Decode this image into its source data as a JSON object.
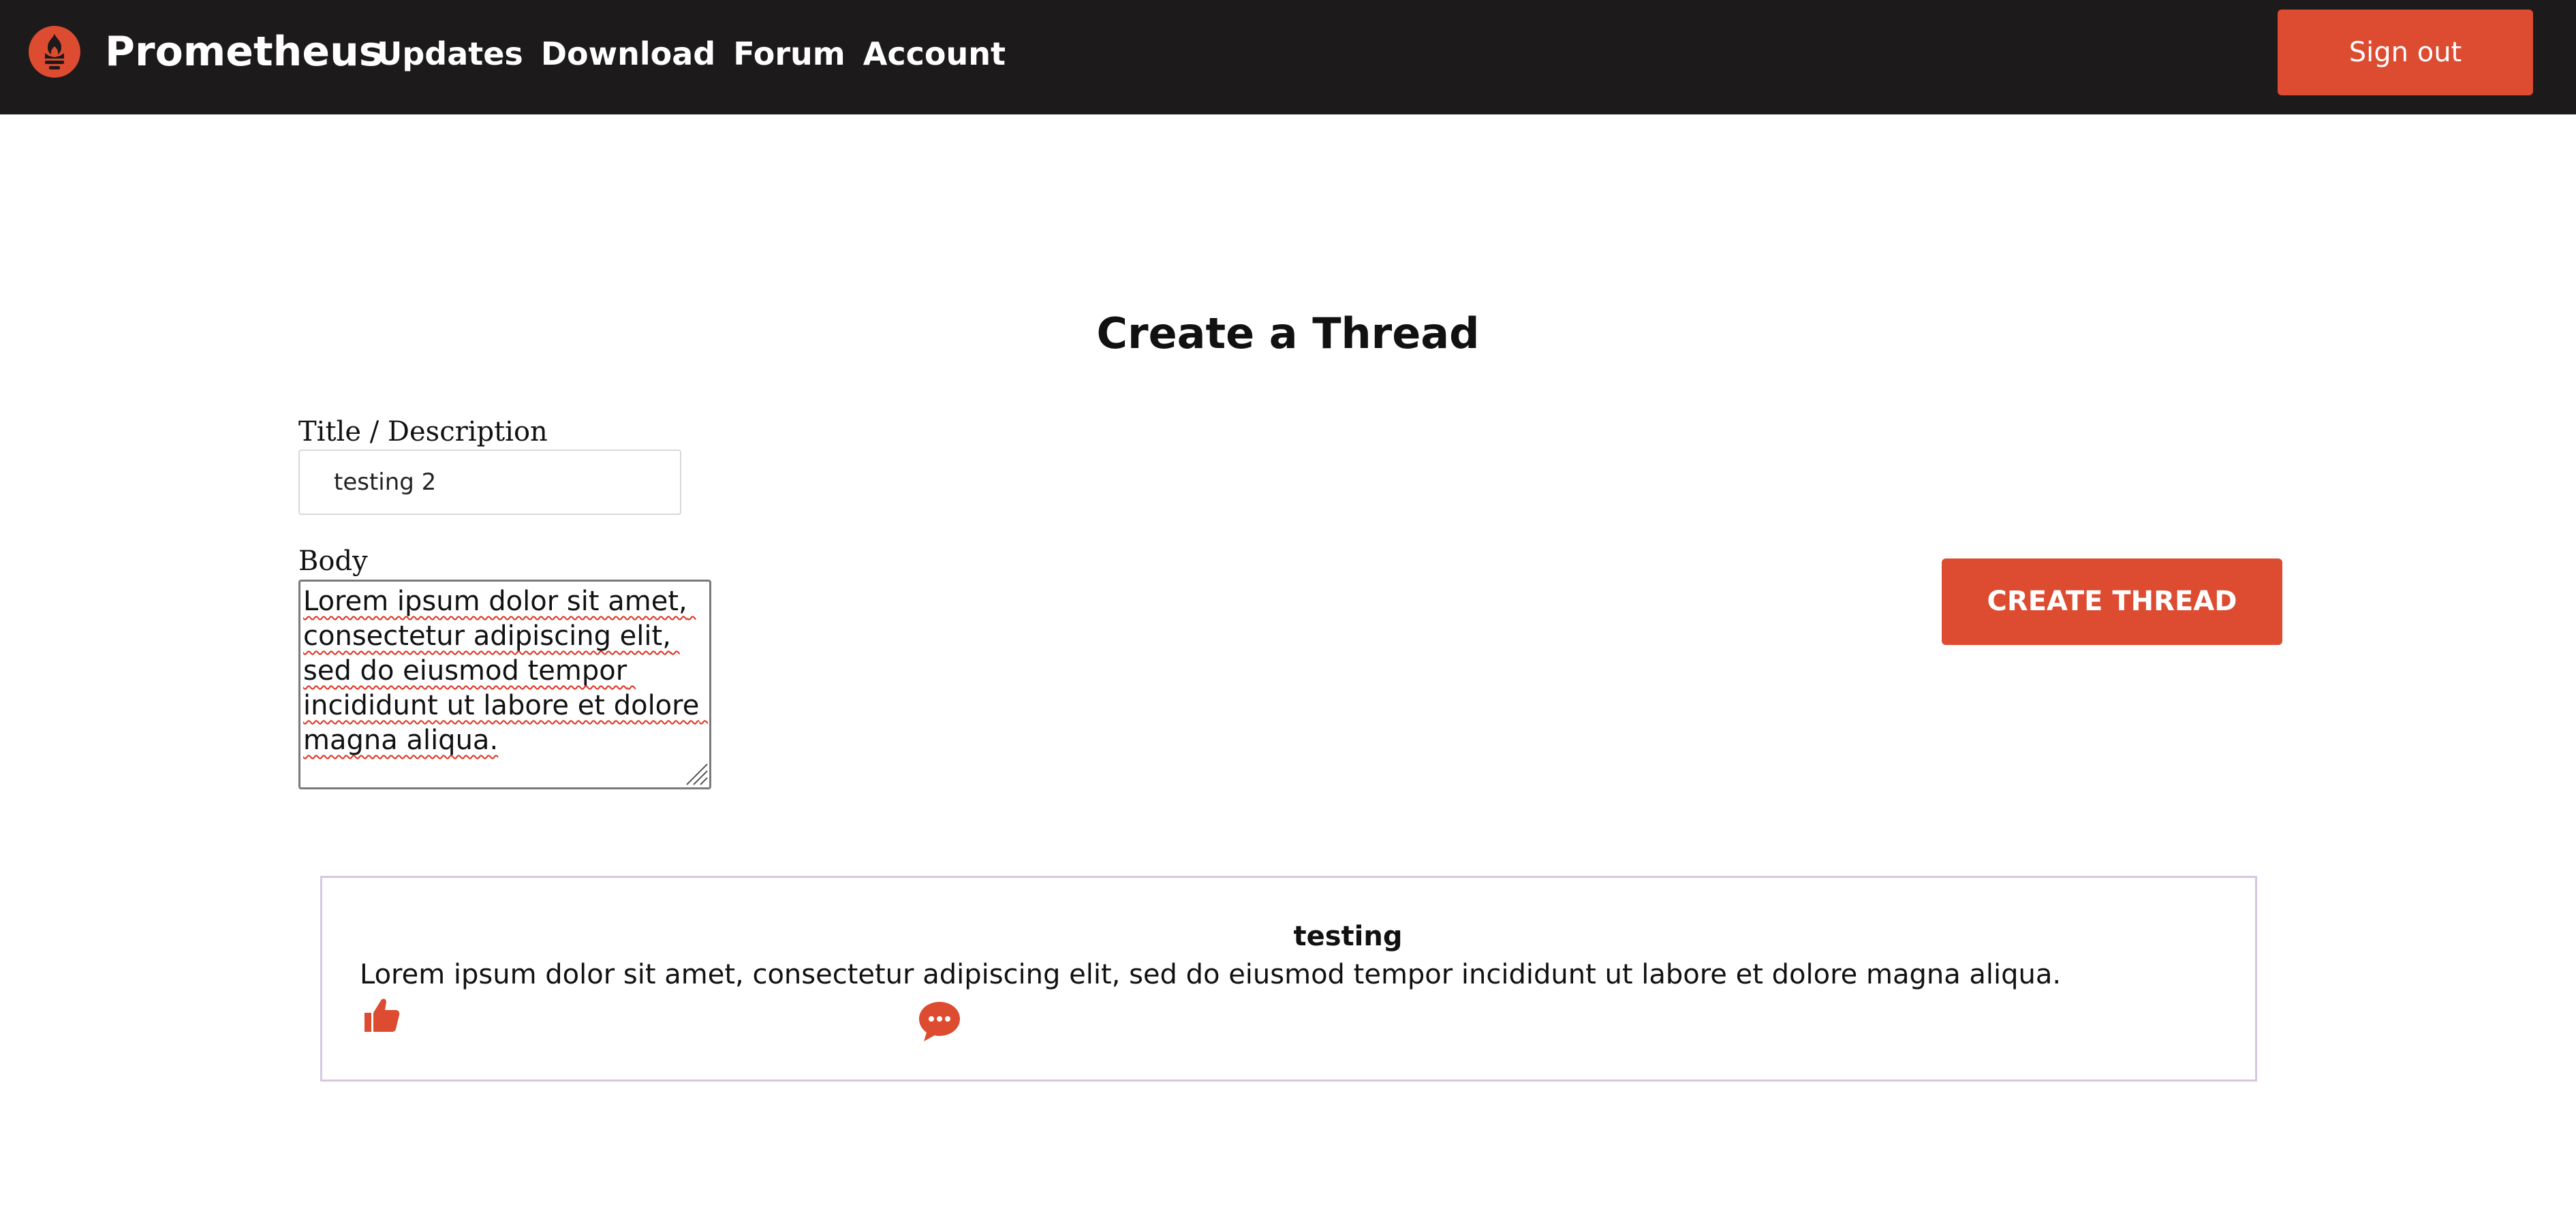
{
  "colors": {
    "nav_bg": "#1c1a1a",
    "accent": "#dd4b30",
    "card_border": "#d4c8e2"
  },
  "header": {
    "logo_icon": "prometheus-torch-logo",
    "brand": "Prometheus",
    "nav_items": [
      {
        "label": "Updates"
      },
      {
        "label": "Download"
      },
      {
        "label": "Forum"
      },
      {
        "label": "Account"
      }
    ],
    "sign_out_label": "Sign out"
  },
  "page": {
    "title": "Create a Thread"
  },
  "form": {
    "title_label": "Title / Description",
    "title_value": "testing 2",
    "body_label": "Body",
    "body_value": "Lorem ipsum dolor sit amet, consectetur adipiscing elit, sed do eiusmod tempor incididunt ut labore et dolore magna aliqua.",
    "submit_label": "CREATE THREAD"
  },
  "threads": [
    {
      "title": "testing",
      "body": "Lorem ipsum dolor sit amet, consectetur adipiscing elit, sed do eiusmod tempor incididunt ut labore et dolore magna aliqua.",
      "like_icon": "thumbs-up-icon",
      "comment_icon": "comment-bubble-icon"
    }
  ]
}
